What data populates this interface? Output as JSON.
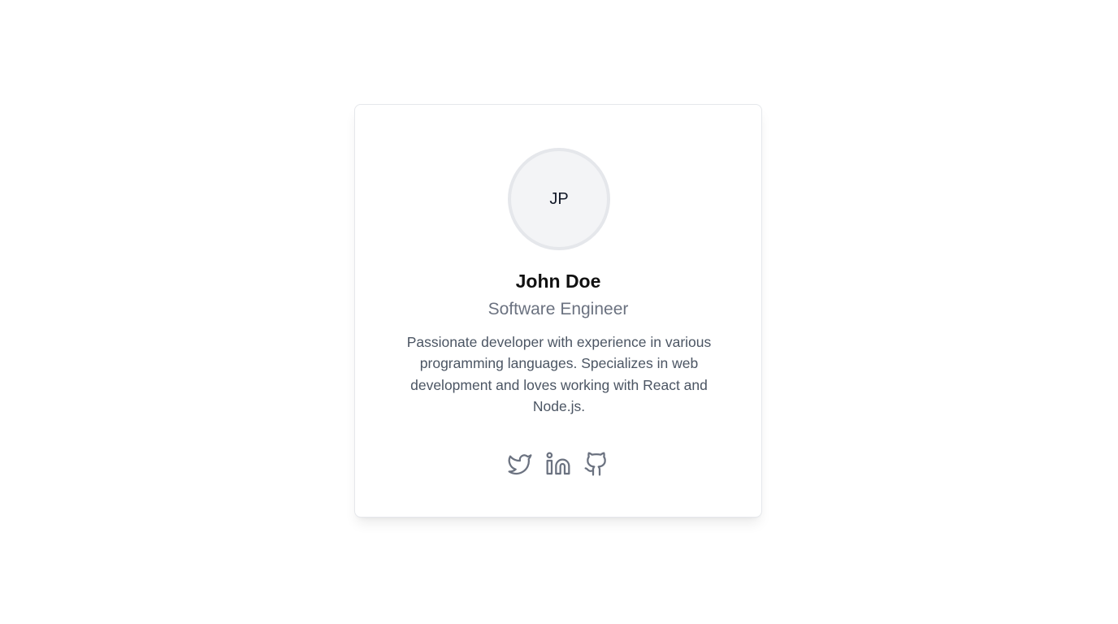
{
  "profile": {
    "avatar_initials": "JP",
    "name": "John Doe",
    "title": "Software Engineer",
    "bio": "Passionate developer with experience in various programming languages. Specializes in web development and loves working with React and Node.js."
  },
  "socials": [
    {
      "icon": "twitter-icon"
    },
    {
      "icon": "linkedin-icon"
    },
    {
      "icon": "github-icon"
    }
  ],
  "colors": {
    "card_border": "#e5e7eb",
    "avatar_bg": "#f3f4f6",
    "name_text": "#111111",
    "title_text": "#6b7280",
    "bio_text": "#4b5563",
    "icon": "#6b7280"
  }
}
